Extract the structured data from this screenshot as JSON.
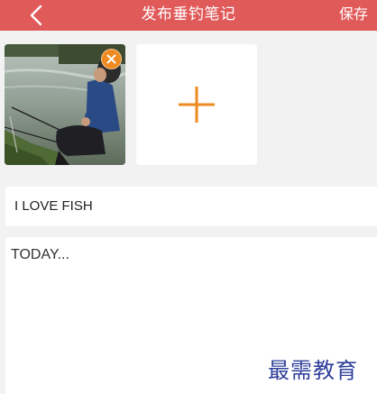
{
  "header": {
    "title": "发布垂钓笔记",
    "save_label": "保存",
    "background_color": "#e05a5a",
    "back_icon": "chevron-left-icon"
  },
  "photos": {
    "uploaded_photo_description": "angler-sitting-by-river",
    "remove_icon": "close-icon",
    "remove_badge_color": "#ef8a20",
    "add_icon": "plus-icon",
    "add_icon_color": "#ef8a20"
  },
  "form": {
    "title_value": "I LOVE FISH",
    "body_value": "TODAY..."
  },
  "watermark": "最需教育"
}
